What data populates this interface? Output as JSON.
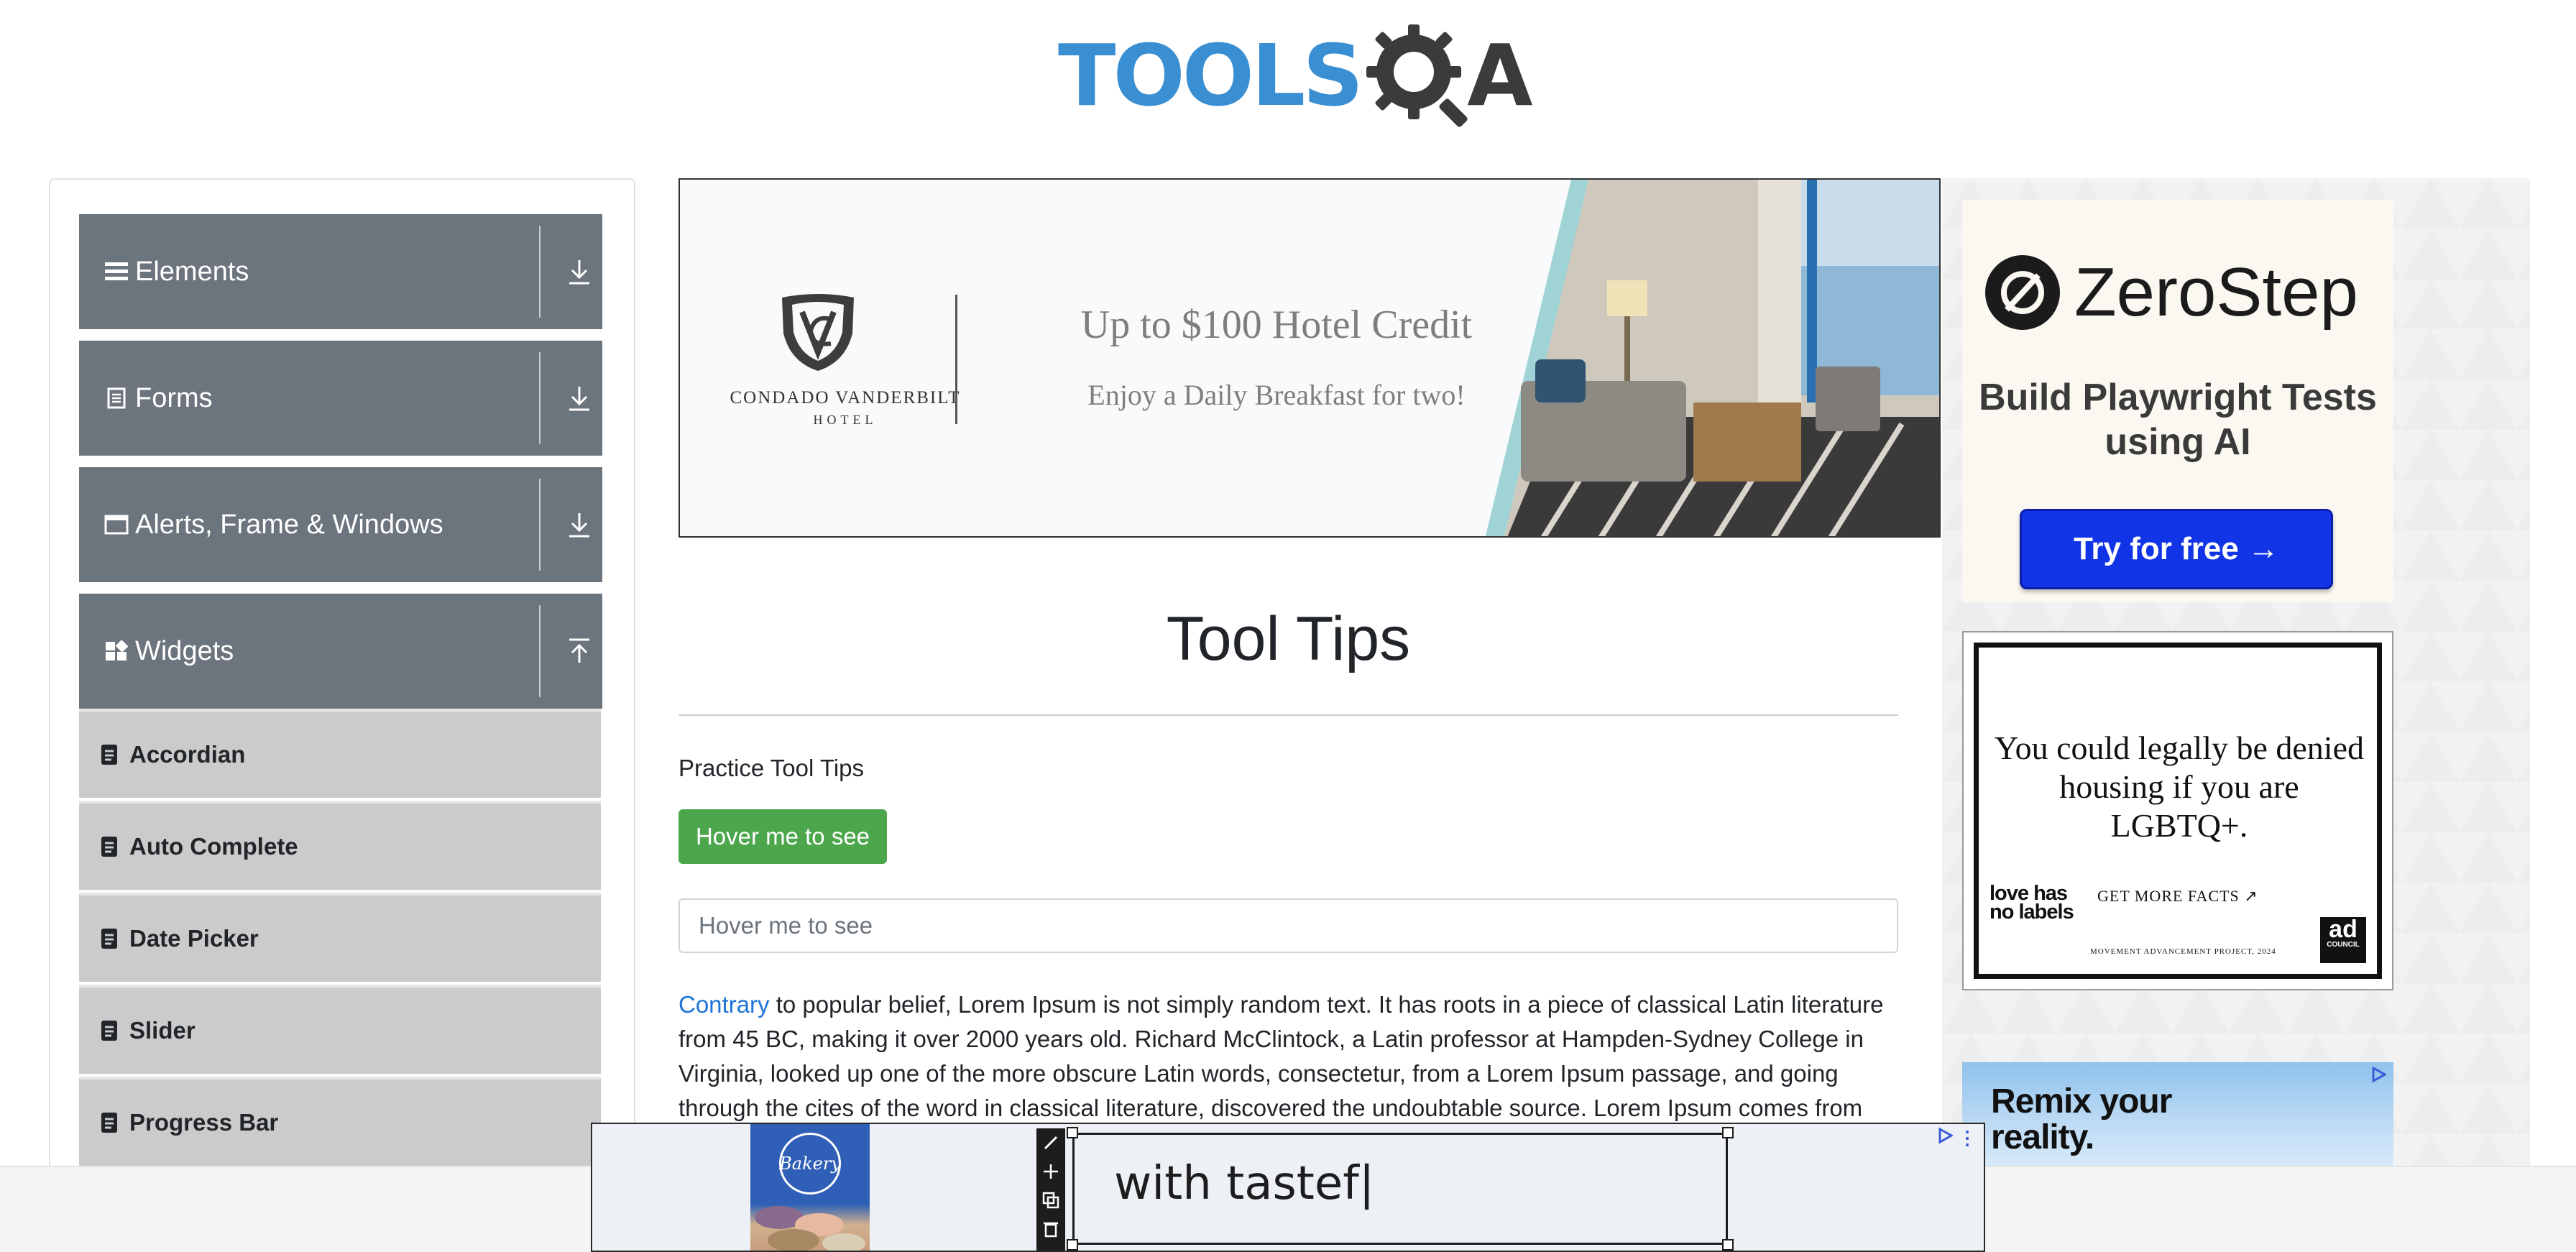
{
  "header": {
    "logo_part1": "TOOLS",
    "logo_part2": "A"
  },
  "sidebar": {
    "groups": [
      {
        "label": "Elements",
        "icon": "list-icon",
        "arrow": "download-arrow-icon"
      },
      {
        "label": "Forms",
        "icon": "form-icon",
        "arrow": "download-arrow-icon"
      },
      {
        "label": "Alerts, Frame & Windows",
        "icon": "window-icon",
        "arrow": "download-arrow-icon"
      },
      {
        "label": "Widgets",
        "icon": "widgets-icon",
        "arrow": "upload-arrow-icon"
      }
    ],
    "items": [
      {
        "label": "Accordian"
      },
      {
        "label": "Auto Complete"
      },
      {
        "label": "Date Picker"
      },
      {
        "label": "Slider"
      },
      {
        "label": "Progress Bar"
      }
    ]
  },
  "banner": {
    "brand": "CONDADO VANDERBILT",
    "brand_sub": "HOTEL",
    "headline": "Up to $100 Hotel Credit",
    "subline": "Enjoy a Daily Breakfast for two!"
  },
  "main": {
    "title": "Tool Tips",
    "practice_label": "Practice Tool Tips",
    "hover_button": "Hover me to see",
    "hover_input_placeholder": "Hover me to see",
    "paragraph_link": "Contrary",
    "paragraph_rest": " to popular belief, Lorem Ipsum is not simply random text. It has roots in a piece of classical Latin literature from 45 BC, making it over 2000 years old. Richard McClintock, a Latin professor at Hampden-Sydney College in Virginia, looked up one of the more obscure Latin words, consectetur, from a Lorem Ipsum passage, and going through the cites of the word in classical literature, discovered the undoubtable source. Lorem Ipsum comes from"
  },
  "ads": {
    "zerostep": {
      "name": "ZeroStep",
      "tagline": "Build Playwright Tests using AI",
      "button": "Try for free →"
    },
    "lgbt": {
      "message": "You could legally be denied housing if you are LGBTQ+.",
      "cta": "GET MORE FACTS ↗",
      "logo_text": "love has no labels",
      "credit": "MOVEMENT ADVANCEMENT PROJECT, 2024",
      "badge": "ad",
      "badge_sub": "COUNCIL"
    },
    "remix": {
      "text": "Remix your reality."
    },
    "bottom": {
      "bakery_logo": "Bakery",
      "edit_text": "with tastef|"
    }
  },
  "colors": {
    "brand_blue": "#3a8ed2",
    "sidebar_header": "#6c757d",
    "success_button": "#4ca64c",
    "link": "#1e73d6",
    "zerostep_button": "#1034e6"
  }
}
